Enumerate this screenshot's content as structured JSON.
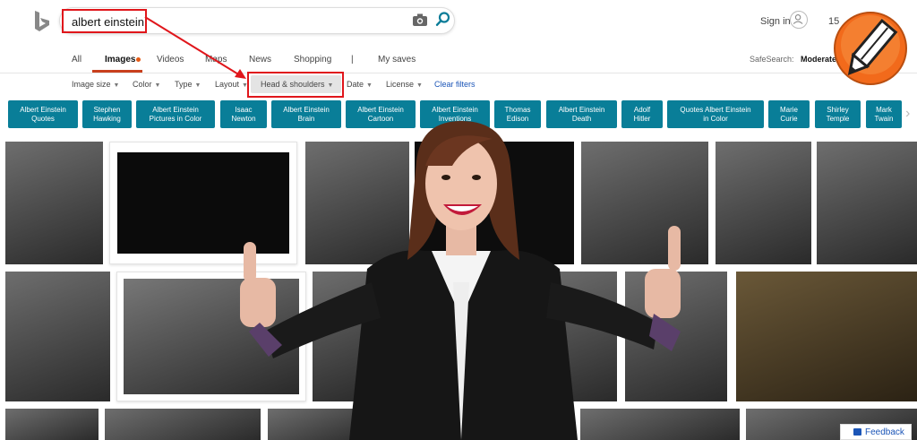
{
  "header": {
    "query": "albert einstein",
    "signin": "Sign in",
    "points": "15"
  },
  "tabs": [
    {
      "label": "All"
    },
    {
      "label": "Images"
    },
    {
      "label": "Videos"
    },
    {
      "label": "Maps"
    },
    {
      "label": "News"
    },
    {
      "label": "Shopping"
    },
    {
      "label": "|"
    },
    {
      "label": "My saves"
    }
  ],
  "safesearch": {
    "label": "SafeSearch:",
    "value": "Moderate"
  },
  "filters": [
    {
      "label": "Image size"
    },
    {
      "label": "Color"
    },
    {
      "label": "Type"
    },
    {
      "label": "Layout"
    },
    {
      "label": "Head & shoulders"
    },
    {
      "label": "Date"
    },
    {
      "label": "License"
    }
  ],
  "clear_filters": "Clear filters",
  "chips": [
    {
      "line1": "Albert Einstein",
      "line2": "Quotes"
    },
    {
      "line1": "Stephen",
      "line2": "Hawking"
    },
    {
      "line1": "Albert Einstein",
      "line2": "Pictures in Color"
    },
    {
      "line1": "Isaac",
      "line2": "Newton"
    },
    {
      "line1": "Albert Einstein",
      "line2": "Brain"
    },
    {
      "line1": "Albert Einstein",
      "line2": "Cartoon"
    },
    {
      "line1": "Albert Einstein",
      "line2": "Inventions"
    },
    {
      "line1": "Thomas",
      "line2": "Edison"
    },
    {
      "line1": "Albert Einstein",
      "line2": "Death"
    },
    {
      "line1": "Adolf",
      "line2": "Hitler"
    },
    {
      "line1": "Quotes Albert Einstein",
      "line2": "in Color"
    },
    {
      "line1": "Marie",
      "line2": "Curie"
    },
    {
      "line1": "Shirley",
      "line2": "Temple"
    },
    {
      "line1": "Mark",
      "line2": "Twain"
    }
  ],
  "feedback": "Feedback",
  "colors": {
    "accent": "#097e98",
    "annotation": "#e0161b",
    "active_tab": "#c9401d"
  }
}
